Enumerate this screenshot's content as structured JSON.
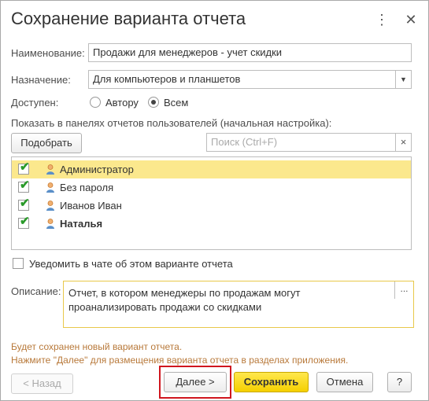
{
  "dialog": {
    "title": "Сохранение варианта отчета",
    "more_icon": "⋮",
    "close_icon": "✕"
  },
  "form": {
    "name_label": "Наименование:",
    "name_value": "Продажи для менеджеров - учет скидки",
    "purpose_label": "Назначение:",
    "purpose_value": "Для компьютеров и планшетов",
    "available_label": "Доступен:",
    "radio_author": "Автору",
    "radio_all": "Всем",
    "radio_selected": "Всем",
    "show_in_panels_label": "Показать в панелях отчетов пользователей (начальная настройка):",
    "pick_button": "Подобрать",
    "search_placeholder": "Поиск (Ctrl+F)",
    "notify_label": "Уведомить в чате об этом варианте отчета",
    "description_label": "Описание:",
    "description_value": "Отчет, в котором менеджеры по продажам могут проанализировать продажи со скидками",
    "info_line1": "Будет сохранен новый вариант отчета.",
    "info_line2": "Нажмите \"Далее\" для размещения варианта отчета в разделах приложения."
  },
  "users": [
    {
      "name": "Администратор",
      "checked": true,
      "selected": true,
      "bold": false
    },
    {
      "name": "Без пароля",
      "checked": true,
      "selected": false,
      "bold": false
    },
    {
      "name": "Иванов Иван",
      "checked": true,
      "selected": false,
      "bold": false
    },
    {
      "name": "Наталья",
      "checked": true,
      "selected": false,
      "bold": true
    }
  ],
  "buttons": {
    "back": "< Назад",
    "next": "Далее >",
    "save": "Сохранить",
    "cancel": "Отмена",
    "help": "?"
  },
  "colors": {
    "accent_yellow": "#f5d000",
    "selected_row": "#fbe88d",
    "highlight_frame": "#d0161e",
    "info_text": "#b8793a",
    "check_green": "#2a9a2a"
  }
}
